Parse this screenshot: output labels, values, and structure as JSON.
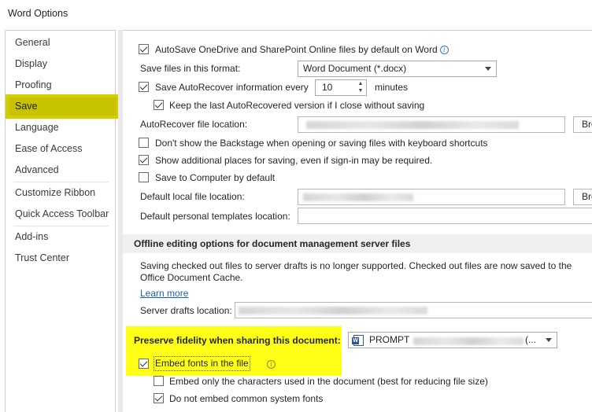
{
  "window": {
    "title": "Word Options"
  },
  "sidebar": {
    "items": [
      {
        "label": "General"
      },
      {
        "label": "Display"
      },
      {
        "label": "Proofing"
      },
      {
        "label": "Save"
      },
      {
        "label": "Language"
      },
      {
        "label": "Ease of Access"
      },
      {
        "label": "Advanced"
      },
      {
        "label": "Customize Ribbon"
      },
      {
        "label": "Quick Access Toolbar"
      },
      {
        "label": "Add-ins"
      },
      {
        "label": "Trust Center"
      }
    ],
    "selected": "Save"
  },
  "save": {
    "autosave_label": "AutoSave OneDrive and SharePoint Online files by default on Word",
    "autosave_checked": true,
    "format_label": "Save files in this format:",
    "format_value": "Word Document (*.docx)",
    "autorecover_label": "Save AutoRecover information every",
    "autorecover_checked": true,
    "autorecover_minutes": "10",
    "minutes_label": "minutes",
    "keep_last_label": "Keep the last AutoRecovered version if I close without saving",
    "keep_last_checked": true,
    "autorecover_location_label": "AutoRecover file location:",
    "browse_label": "Browse...",
    "dont_show_backstage_label": "Don't show the Backstage when opening or saving files with keyboard shortcuts",
    "dont_show_backstage_checked": false,
    "show_additional_label": "Show additional places for saving, even if sign-in may be required.",
    "show_additional_checked": true,
    "save_to_computer_label": "Save to Computer by default",
    "save_to_computer_checked": false,
    "default_local_label": "Default local file location:",
    "default_templates_label": "Default personal templates location:"
  },
  "offline": {
    "header": "Offline editing options for document management server files",
    "description": "Saving checked out files to server drafts is no longer supported. Checked out files are now saved to the Office Document Cache.",
    "learn_more": "Learn more",
    "server_drafts_label": "Server drafts location:"
  },
  "fidelity": {
    "header": "Preserve fidelity when sharing this document:",
    "document_value": "PROMPT",
    "embed_fonts_label": "Embed fonts in the file",
    "embed_fonts_checked": true,
    "embed_only_used_label": "Embed only the characters used in the document (best for reducing file size)",
    "embed_only_used_checked": false,
    "do_not_embed_common_label": "Do not embed common system fonts",
    "do_not_embed_common_checked": true
  },
  "colors": {
    "highlight_yellow": "#ffff17",
    "selected_nav": "#c9c400",
    "link": "#1a5fb4",
    "info_icon": "#2b79d1"
  },
  "icons": [
    "info-icon",
    "dropdown-arrow-icon",
    "spin-up-icon",
    "spin-down-icon",
    "word-document-icon",
    "checkbox-checked-icon"
  ]
}
